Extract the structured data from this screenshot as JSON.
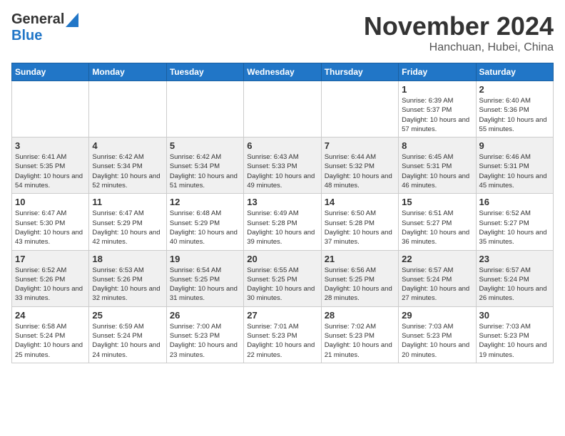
{
  "header": {
    "logo_line1": "General",
    "logo_line2": "Blue",
    "month": "November 2024",
    "location": "Hanchuan, Hubei, China"
  },
  "weekdays": [
    "Sunday",
    "Monday",
    "Tuesday",
    "Wednesday",
    "Thursday",
    "Friday",
    "Saturday"
  ],
  "weeks": [
    [
      {
        "day": "",
        "content": ""
      },
      {
        "day": "",
        "content": ""
      },
      {
        "day": "",
        "content": ""
      },
      {
        "day": "",
        "content": ""
      },
      {
        "day": "",
        "content": ""
      },
      {
        "day": "1",
        "content": "Sunrise: 6:39 AM\nSunset: 5:37 PM\nDaylight: 10 hours and 57 minutes."
      },
      {
        "day": "2",
        "content": "Sunrise: 6:40 AM\nSunset: 5:36 PM\nDaylight: 10 hours and 55 minutes."
      }
    ],
    [
      {
        "day": "3",
        "content": "Sunrise: 6:41 AM\nSunset: 5:35 PM\nDaylight: 10 hours and 54 minutes."
      },
      {
        "day": "4",
        "content": "Sunrise: 6:42 AM\nSunset: 5:34 PM\nDaylight: 10 hours and 52 minutes."
      },
      {
        "day": "5",
        "content": "Sunrise: 6:42 AM\nSunset: 5:34 PM\nDaylight: 10 hours and 51 minutes."
      },
      {
        "day": "6",
        "content": "Sunrise: 6:43 AM\nSunset: 5:33 PM\nDaylight: 10 hours and 49 minutes."
      },
      {
        "day": "7",
        "content": "Sunrise: 6:44 AM\nSunset: 5:32 PM\nDaylight: 10 hours and 48 minutes."
      },
      {
        "day": "8",
        "content": "Sunrise: 6:45 AM\nSunset: 5:31 PM\nDaylight: 10 hours and 46 minutes."
      },
      {
        "day": "9",
        "content": "Sunrise: 6:46 AM\nSunset: 5:31 PM\nDaylight: 10 hours and 45 minutes."
      }
    ],
    [
      {
        "day": "10",
        "content": "Sunrise: 6:47 AM\nSunset: 5:30 PM\nDaylight: 10 hours and 43 minutes."
      },
      {
        "day": "11",
        "content": "Sunrise: 6:47 AM\nSunset: 5:29 PM\nDaylight: 10 hours and 42 minutes."
      },
      {
        "day": "12",
        "content": "Sunrise: 6:48 AM\nSunset: 5:29 PM\nDaylight: 10 hours and 40 minutes."
      },
      {
        "day": "13",
        "content": "Sunrise: 6:49 AM\nSunset: 5:28 PM\nDaylight: 10 hours and 39 minutes."
      },
      {
        "day": "14",
        "content": "Sunrise: 6:50 AM\nSunset: 5:28 PM\nDaylight: 10 hours and 37 minutes."
      },
      {
        "day": "15",
        "content": "Sunrise: 6:51 AM\nSunset: 5:27 PM\nDaylight: 10 hours and 36 minutes."
      },
      {
        "day": "16",
        "content": "Sunrise: 6:52 AM\nSunset: 5:27 PM\nDaylight: 10 hours and 35 minutes."
      }
    ],
    [
      {
        "day": "17",
        "content": "Sunrise: 6:52 AM\nSunset: 5:26 PM\nDaylight: 10 hours and 33 minutes."
      },
      {
        "day": "18",
        "content": "Sunrise: 6:53 AM\nSunset: 5:26 PM\nDaylight: 10 hours and 32 minutes."
      },
      {
        "day": "19",
        "content": "Sunrise: 6:54 AM\nSunset: 5:25 PM\nDaylight: 10 hours and 31 minutes."
      },
      {
        "day": "20",
        "content": "Sunrise: 6:55 AM\nSunset: 5:25 PM\nDaylight: 10 hours and 30 minutes."
      },
      {
        "day": "21",
        "content": "Sunrise: 6:56 AM\nSunset: 5:25 PM\nDaylight: 10 hours and 28 minutes."
      },
      {
        "day": "22",
        "content": "Sunrise: 6:57 AM\nSunset: 5:24 PM\nDaylight: 10 hours and 27 minutes."
      },
      {
        "day": "23",
        "content": "Sunrise: 6:57 AM\nSunset: 5:24 PM\nDaylight: 10 hours and 26 minutes."
      }
    ],
    [
      {
        "day": "24",
        "content": "Sunrise: 6:58 AM\nSunset: 5:24 PM\nDaylight: 10 hours and 25 minutes."
      },
      {
        "day": "25",
        "content": "Sunrise: 6:59 AM\nSunset: 5:24 PM\nDaylight: 10 hours and 24 minutes."
      },
      {
        "day": "26",
        "content": "Sunrise: 7:00 AM\nSunset: 5:23 PM\nDaylight: 10 hours and 23 minutes."
      },
      {
        "day": "27",
        "content": "Sunrise: 7:01 AM\nSunset: 5:23 PM\nDaylight: 10 hours and 22 minutes."
      },
      {
        "day": "28",
        "content": "Sunrise: 7:02 AM\nSunset: 5:23 PM\nDaylight: 10 hours and 21 minutes."
      },
      {
        "day": "29",
        "content": "Sunrise: 7:03 AM\nSunset: 5:23 PM\nDaylight: 10 hours and 20 minutes."
      },
      {
        "day": "30",
        "content": "Sunrise: 7:03 AM\nSunset: 5:23 PM\nDaylight: 10 hours and 19 minutes."
      }
    ]
  ]
}
